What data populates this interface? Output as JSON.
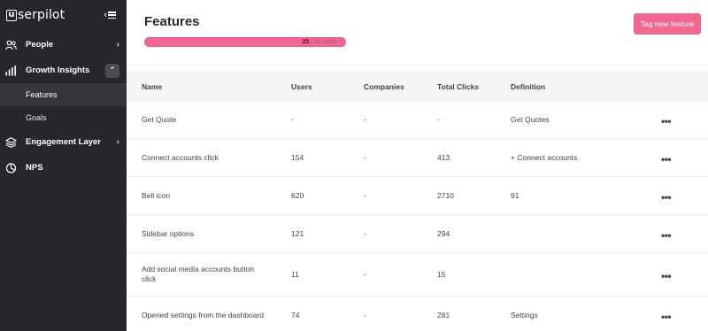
{
  "app": {
    "logo_text": "serpilot",
    "logo_mark": "u"
  },
  "sidebar": {
    "items": [
      {
        "label": "People",
        "icon": "people-icon"
      },
      {
        "label": "Growth Insights",
        "icon": "bar-chart-icon"
      },
      {
        "label": "Engagement Layer",
        "icon": "layers-icon"
      },
      {
        "label": "NPS",
        "icon": "pie-chart-icon"
      }
    ],
    "sub_items": [
      {
        "label": "Features",
        "active": true
      },
      {
        "label": "Goals",
        "active": false
      }
    ]
  },
  "header": {
    "title": "Features",
    "usage_used": "25",
    "usage_rest": " / 25 used",
    "usage_progress": 1.0,
    "tag_button": "Tag new feature"
  },
  "table": {
    "columns": [
      "Name",
      "Users",
      "Companies",
      "Total Clicks",
      "Definition"
    ],
    "rows": [
      {
        "name": "Get Quote",
        "users": "-",
        "companies": "-",
        "clicks": "-",
        "definition": "Get Quotes"
      },
      {
        "name": "Connect accounts click",
        "users": "154",
        "companies": "-",
        "clicks": "413",
        "definition": "+ Connect accounts"
      },
      {
        "name": "Bell icon",
        "users": "620",
        "companies": "-",
        "clicks": "2710",
        "definition": "91"
      },
      {
        "name": "Sidebar options",
        "users": "121",
        "companies": "-",
        "clicks": "294",
        "definition": ""
      },
      {
        "name": "Add social media accounts button click",
        "users": "11",
        "companies": "-",
        "clicks": "15",
        "definition": ""
      },
      {
        "name": "Opened settings from the dashboard",
        "users": "74",
        "companies": "-",
        "clicks": "281",
        "definition": "Settings"
      }
    ],
    "more_label": "•••"
  },
  "colors": {
    "sidebar_bg": "#25272b",
    "accent": "#f0678f",
    "header_bg": "#f5f5f5"
  }
}
